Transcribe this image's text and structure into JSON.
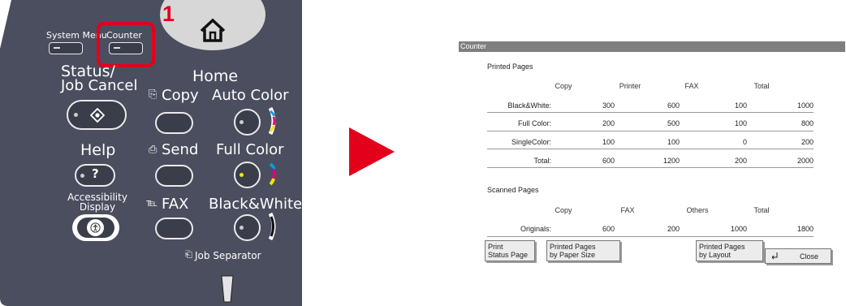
{
  "panel": {
    "callout_number": "1",
    "system_menu_label": "System Menu",
    "counter_label": "Counter",
    "status_label_line1": "Status/",
    "status_label_line2": "Job Cancel",
    "home_label": "Home",
    "copy_label": "Copy",
    "auto_color_label": "Auto Color",
    "help_label": "Help",
    "send_label": "Send",
    "full_color_label": "Full Color",
    "accessibility_line1": "Accessibility",
    "accessibility_line2": "Display",
    "fax_label": "FAX",
    "black_white_label": "Black&White",
    "job_separator_label": "Job Separator"
  },
  "screen": {
    "title": "Counter",
    "printed": {
      "section_label": "Printed Pages",
      "columns": [
        "Copy",
        "Printer",
        "FAX",
        "Total"
      ],
      "rows": [
        {
          "label": "Black&White:",
          "values": [
            "300",
            "600",
            "100",
            "1000"
          ]
        },
        {
          "label": "Full Color:",
          "values": [
            "200",
            "500",
            "100",
            "800"
          ]
        },
        {
          "label": "SingleColor:",
          "values": [
            "100",
            "100",
            "0",
            "200"
          ]
        },
        {
          "label": "Total:",
          "values": [
            "600",
            "1200",
            "200",
            "2000"
          ]
        }
      ]
    },
    "scanned": {
      "section_label": "Scanned Pages",
      "columns": [
        "Copy",
        "FAX",
        "Others",
        "Total"
      ],
      "rows": [
        {
          "label": "Originals:",
          "values": [
            "600",
            "200",
            "1000",
            "1800"
          ]
        }
      ]
    },
    "buttons": {
      "print_status_line1": "Print",
      "print_status_line2": "Status Page",
      "by_paper_size_line1": "Printed Pages",
      "by_paper_size_line2": "by Paper Size",
      "by_layout_line1": "Printed Pages",
      "by_layout_line2": "by Layout",
      "close": "Close"
    }
  },
  "colors": {
    "panel_body": "#4b4e5e",
    "callout_red": "#e3001b",
    "arrow_red": "#e3001b",
    "titlebar_gray": "#7f7f7f"
  }
}
